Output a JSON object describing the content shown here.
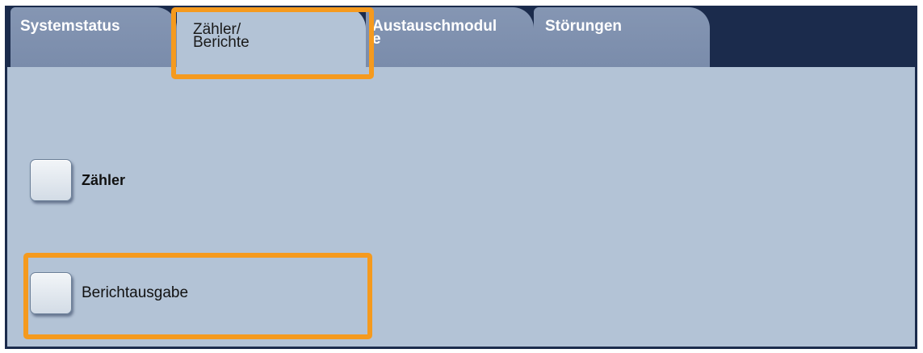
{
  "tabs": [
    {
      "line1": "Systemstatus",
      "line2": ""
    },
    {
      "line1": "Zähler/",
      "line2": "Berichte"
    },
    {
      "line1": "Austauschmodul",
      "line2": "e"
    },
    {
      "line1": "Störungen",
      "line2": ""
    }
  ],
  "active_tab_index": 1,
  "options": [
    {
      "label": "Zähler"
    },
    {
      "label": "Berichtausgabe"
    }
  ],
  "colors": {
    "tab_bar": "#1b2b4c",
    "panel": "#b3c3d6",
    "inactive_tab": "#8596b3",
    "highlight": "#f59a1e"
  }
}
